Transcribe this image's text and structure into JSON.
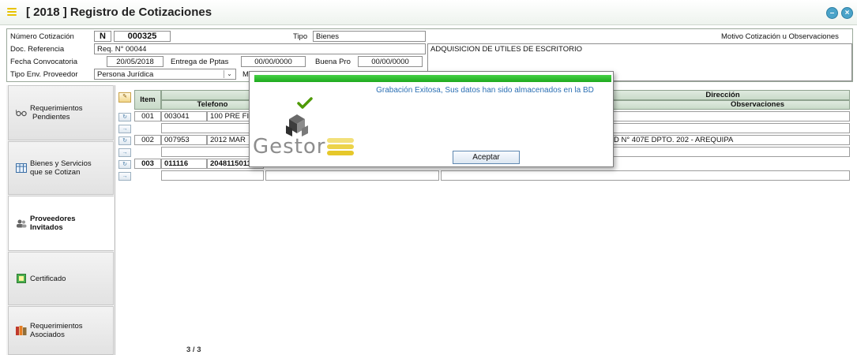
{
  "window": {
    "title": "[ 2018 ] Registro de Cotizaciones",
    "minimize_label": "–",
    "close_label": "×"
  },
  "header": {
    "numero_label": "Número Cotización",
    "numero_type": "N",
    "numero_value": "000325",
    "tipo_label": "Tipo",
    "tipo_value": "Bienes",
    "motivo_label": "Motivo Cotización u Observaciones",
    "doc_label": "Doc. Referencia",
    "doc_value": "Req. N° 00044",
    "motivo_value": "ADQUISICION DE UTILES DE ESCRITORIO",
    "fecha_label": "Fecha Convocatoria",
    "fecha_value": "20/05/2018",
    "entrega_label": "Entrega de Pptas",
    "entrega_value": "00/00/0000",
    "buenapro_label": "Buena Pro",
    "buenapro_value": "00/00/0000",
    "tipoenv_label": "Tipo Env. Proveedor",
    "tipoenv_value": "Persona Jurídica",
    "m_label": "M"
  },
  "sidebar": {
    "items": [
      {
        "label1": "Requerimientos",
        "label2": "Pendientes",
        "icon": "glasses-icon"
      },
      {
        "label1": "Bienes y Servicios",
        "label2": "que se Cotizan",
        "icon": "grid-icon"
      },
      {
        "label1": "Proveedores",
        "label2": "Invitados",
        "icon": "people-icon"
      },
      {
        "label1": "Certificado",
        "label2": "",
        "icon": "certificate-icon"
      },
      {
        "label1": "Requerimientos",
        "label2": "Asociados",
        "icon": "books-icon"
      }
    ]
  },
  "grid": {
    "col_item": "Item",
    "col_telefono": "Telefono",
    "col_direccion": "Dirección",
    "col_observaciones": "Observaciones",
    "rows": [
      {
        "item": "001",
        "code": "003041",
        "name": "100 PRE FI",
        "direccion": ""
      },
      {
        "item": "002",
        "code": "007953",
        "name": "2012 MAR",
        "direccion": "D N° 407E DPTO. 202 - AREQUIPA"
      },
      {
        "item": "003",
        "code": "011116",
        "name": "2048115011",
        "direccion": ""
      }
    ],
    "pager": "3 / 3"
  },
  "dialog": {
    "message": "Grabación Exitosa, Sus datos han sido almacenados en la BD",
    "ok_label": "Aceptar",
    "logo_text": "Gestor"
  },
  "colors": {
    "accent_green": "#1eaa1e",
    "message_blue": "#2b6fb3"
  }
}
